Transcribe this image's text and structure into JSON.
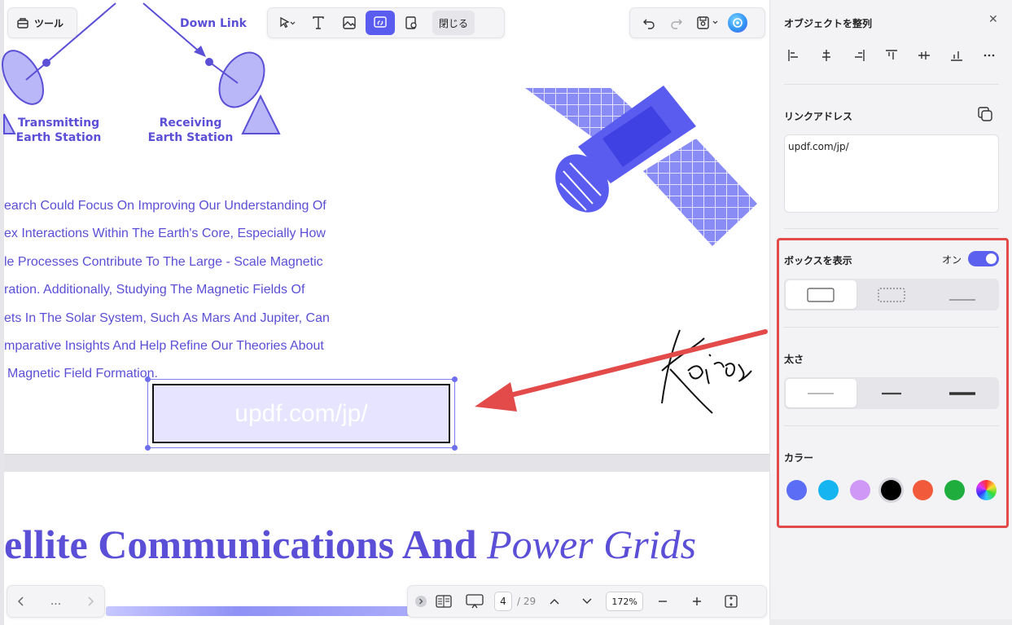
{
  "toolbar": {
    "tools_label": "ツール",
    "close_label": "閉じる"
  },
  "diagram": {
    "downlink_label": "Down Link",
    "transmitting_label_1": "Transmitting",
    "transmitting_label_2": "Earth Station",
    "receiving_label_1": "Receiving",
    "receiving_label_2": "Earth Station"
  },
  "document": {
    "paragraph_lines": [
      "earch Could Focus On Improving Our Understanding Of",
      "ex Interactions Within The Earth's Core, Especially How",
      "le Processes Contribute To The Large - Scale Magnetic",
      "ration. Additionally, Studying The Magnetic Fields Of",
      "ets In The Solar System, Such As Mars And Jupiter, Can",
      "mparative Insights And Help Refine Our Theories About",
      "Magnetic Field Formation."
    ],
    "link_box_text": "updf.com/jp/",
    "signature_text": "Kairos",
    "page2_title_bold": "ellite Communications And ",
    "page2_title_italic": "Power Grids"
  },
  "bottom_bar": {
    "nav_more": "...",
    "current_page": "4",
    "total_pages": "/ 29",
    "zoom": "172%"
  },
  "panel": {
    "title": "オブジェクトを整列",
    "link_address_label": "リンクアドレス",
    "link_address_value": "updf.com/jp/",
    "show_box_label": "ボックスを表示",
    "toggle_state": "オン",
    "thickness_label": "太さ",
    "color_label": "カラー",
    "colors": [
      "#5b6cf5",
      "#17b4f2",
      "#cf98f6",
      "#000000",
      "#f15a3a",
      "#1fae3e",
      "rainbow"
    ],
    "selected_color": "#000000"
  }
}
